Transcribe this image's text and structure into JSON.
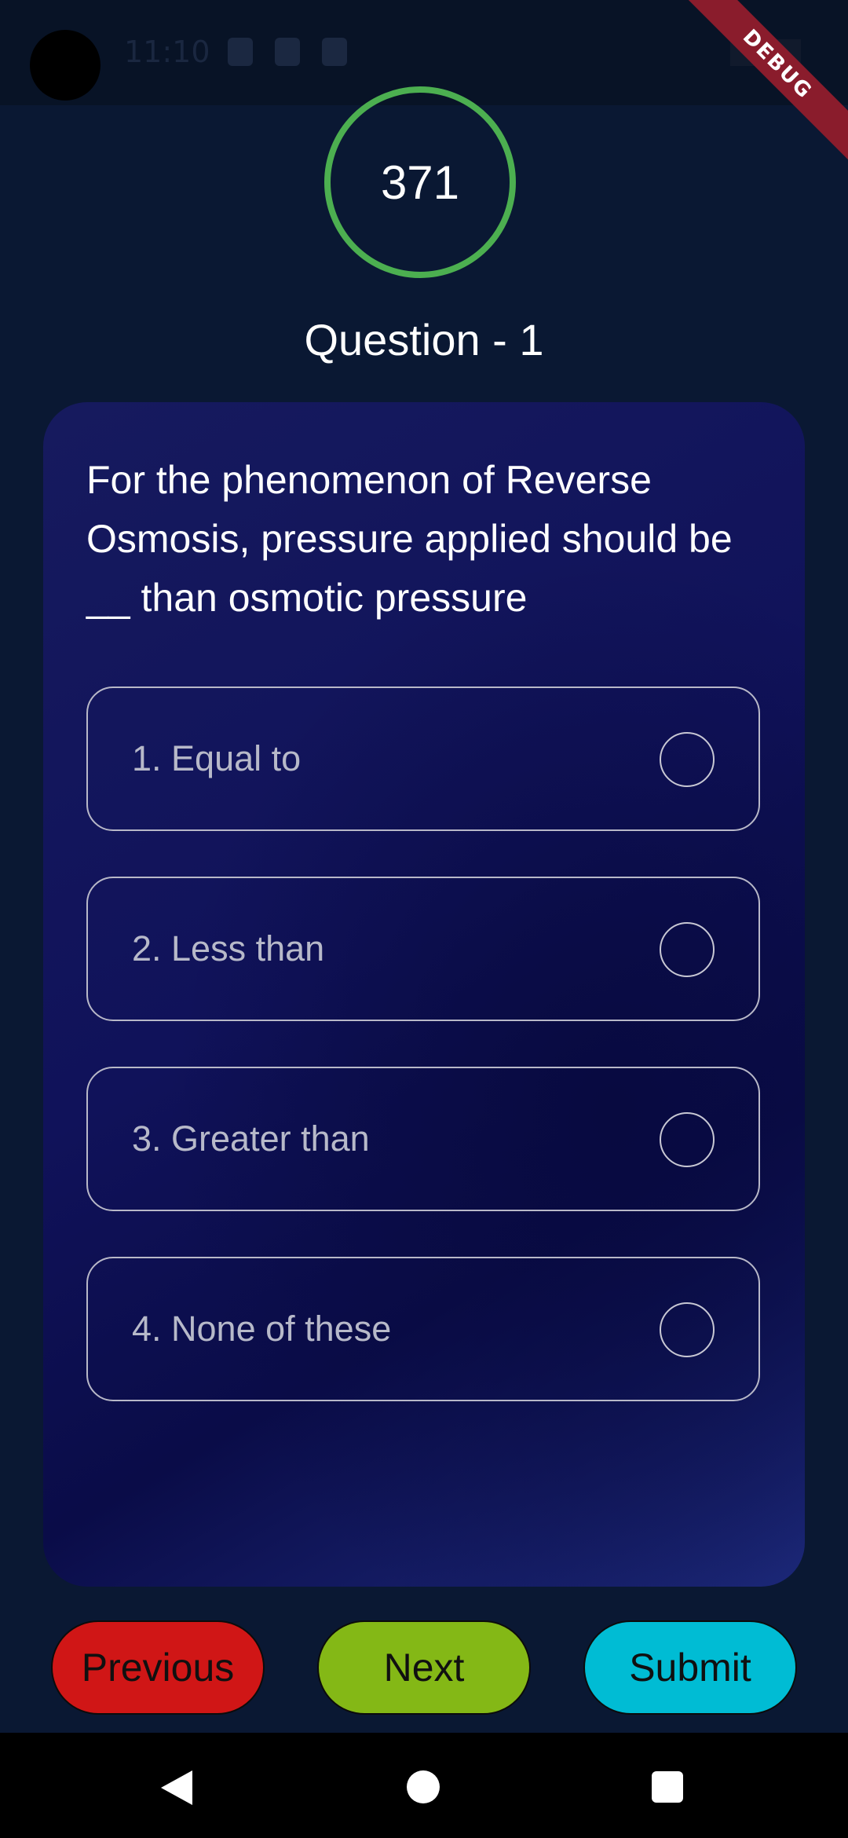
{
  "status_bar": {
    "time": "11:10"
  },
  "debug_banner": {
    "text": "DEBUG"
  },
  "timer": {
    "value": "371",
    "ring_color": "#4caf50"
  },
  "question": {
    "title": "Question - 1",
    "text": "For the phenomenon of Reverse Osmosis, pressure applied should be __ than osmotic pressure",
    "options": [
      {
        "label": "1. Equal to"
      },
      {
        "label": "2. Less than"
      },
      {
        "label": "3. Greater than"
      },
      {
        "label": "4. None of these"
      }
    ]
  },
  "buttons": {
    "previous": {
      "label": "Previous",
      "color": "#d01616"
    },
    "next": {
      "label": "Next",
      "color": "#84b816"
    },
    "submit": {
      "label": "Submit",
      "color": "#00bcd4"
    }
  },
  "nav": {
    "back_icon": "back-triangle",
    "home_icon": "home-circle",
    "recents_icon": "recents-square"
  }
}
